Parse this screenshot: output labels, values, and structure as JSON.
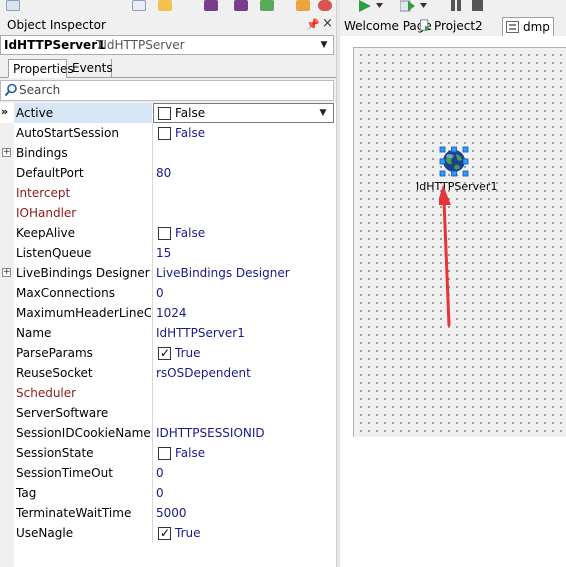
{
  "inspector": {
    "title": "Object Inspector",
    "selected_object": {
      "name": "IdHTTPServer1",
      "type": "TIdHTTPServer"
    },
    "tabs": [
      {
        "label": "Properties",
        "active": true
      },
      {
        "label": "Events",
        "active": false
      }
    ],
    "search": {
      "placeholder": "Search",
      "value": ""
    }
  },
  "properties": [
    {
      "name": "Active",
      "value": "False",
      "checkbox": true,
      "checked": false,
      "selected": true
    },
    {
      "name": "AutoStartSession",
      "value": "False",
      "checkbox": true,
      "checked": false
    },
    {
      "name": "Bindings",
      "value": "",
      "expandable": true
    },
    {
      "name": "DefaultPort",
      "value": "80"
    },
    {
      "name": "Intercept",
      "value": "",
      "reference": true
    },
    {
      "name": "IOHandler",
      "value": "",
      "reference": true
    },
    {
      "name": "KeepAlive",
      "value": "False",
      "checkbox": true,
      "checked": false
    },
    {
      "name": "ListenQueue",
      "value": "15"
    },
    {
      "name": "LiveBindings Designer",
      "value": "LiveBindings Designer",
      "expandable": true
    },
    {
      "name": "MaxConnections",
      "value": "0"
    },
    {
      "name": "MaximumHeaderLineCount",
      "value": "1024"
    },
    {
      "name": "Name",
      "value": "IdHTTPServer1"
    },
    {
      "name": "ParseParams",
      "value": "True",
      "checkbox": true,
      "checked": true
    },
    {
      "name": "ReuseSocket",
      "value": "rsOSDependent"
    },
    {
      "name": "Scheduler",
      "value": "",
      "reference": true
    },
    {
      "name": "ServerSoftware",
      "value": ""
    },
    {
      "name": "SessionIDCookieName",
      "value": "IDHTTPSESSIONID"
    },
    {
      "name": "SessionState",
      "value": "False",
      "checkbox": true,
      "checked": false
    },
    {
      "name": "SessionTimeOut",
      "value": "0"
    },
    {
      "name": "Tag",
      "value": "0"
    },
    {
      "name": "TerminateWaitTime",
      "value": "5000"
    },
    {
      "name": "UseNagle",
      "value": "True",
      "checkbox": true,
      "checked": true
    }
  ],
  "doc_tabs": [
    {
      "label": "Welcome Page"
    },
    {
      "label": "Project2"
    },
    {
      "label": "dmp",
      "active": true
    }
  ],
  "designer": {
    "component_label": "IdHTTPServer1",
    "component_icon": "globe-icon"
  },
  "colors": {
    "reference_property": "#8b1a1a",
    "value_text": "#1a1a8c",
    "annotation_arrow": "#e8333a"
  }
}
